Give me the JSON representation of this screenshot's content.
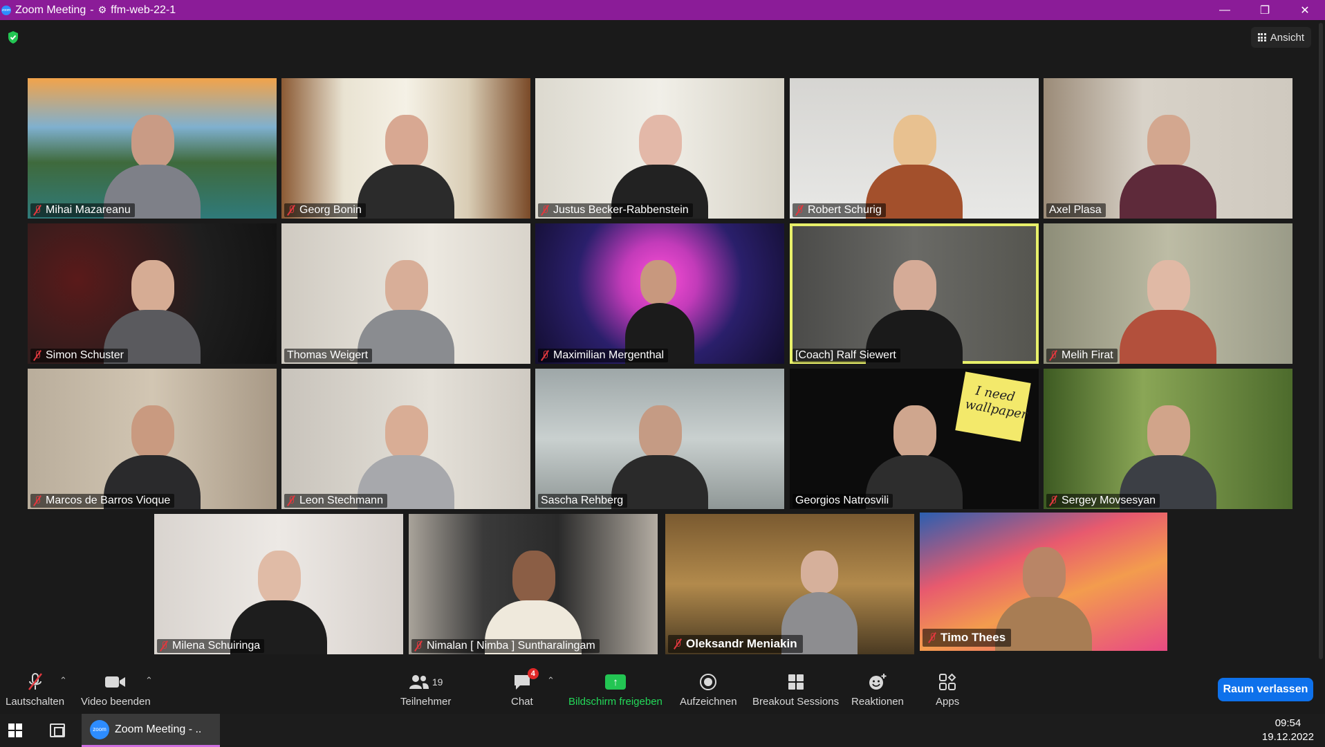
{
  "window": {
    "app_logo": "zoom",
    "title": "Zoom Meeting",
    "separator": "-",
    "meeting_name": "ffm-web-22-1",
    "controls": [
      "minimize-icon",
      "restore-icon",
      "close-icon"
    ]
  },
  "view_button": {
    "label": "Ansicht"
  },
  "participants": [
    {
      "name": "Mihai Mazareanu",
      "muted": true
    },
    {
      "name": "Georg Bonin",
      "muted": true
    },
    {
      "name": "Justus Becker-Rabbenstein",
      "muted": true
    },
    {
      "name": "Robert Schurig",
      "muted": true
    },
    {
      "name": "Axel Plasa",
      "muted": false
    },
    {
      "name": "Simon Schuster",
      "muted": true
    },
    {
      "name": "Thomas Weigert",
      "muted": false
    },
    {
      "name": "Maximilian Mergenthal",
      "muted": true
    },
    {
      "name": "[Coach] Ralf Siewert",
      "muted": false,
      "active_speaker": true
    },
    {
      "name": "Melih Firat",
      "muted": true
    },
    {
      "name": "Marcos de Barros Vioque",
      "muted": true
    },
    {
      "name": "Leon Stechmann",
      "muted": true
    },
    {
      "name": "Sascha Rehberg",
      "muted": false
    },
    {
      "name": "Georgios Natrosvili",
      "muted": false
    },
    {
      "name": "Sergey Movsesyan",
      "muted": true
    },
    {
      "name": "Milena Schuiringa",
      "muted": true
    },
    {
      "name": "Nimalan [ Nimba ] Suntharalingam",
      "muted": true
    },
    {
      "name": "Oleksandr Meniakin",
      "muted": true
    },
    {
      "name": "Timo Thees",
      "muted": true
    }
  ],
  "sticky_note": "I need wallpaper",
  "toolbar": {
    "mute_label": "Lautschalten",
    "video_label": "Video beenden",
    "participants_label": "Teilnehmer",
    "participants_count": "19",
    "chat_label": "Chat",
    "chat_badge": "4",
    "share_label": "Bildschirm freigeben",
    "record_label": "Aufzeichnen",
    "breakout_label": "Breakout Sessions",
    "reactions_label": "Reaktionen",
    "apps_label": "Apps",
    "leave_label": "Raum verlassen"
  },
  "taskbar": {
    "app_logo": "zoom",
    "app_label": "Zoom Meeting - ..",
    "time": "09:54",
    "date": "19.12.2022"
  },
  "colors": {
    "titlebar": "#8b1c98",
    "active_speaker_border": "#e8f06a",
    "muted_icon": "#e0383e",
    "share_green": "#23c553",
    "leave_blue": "#0e71eb"
  }
}
